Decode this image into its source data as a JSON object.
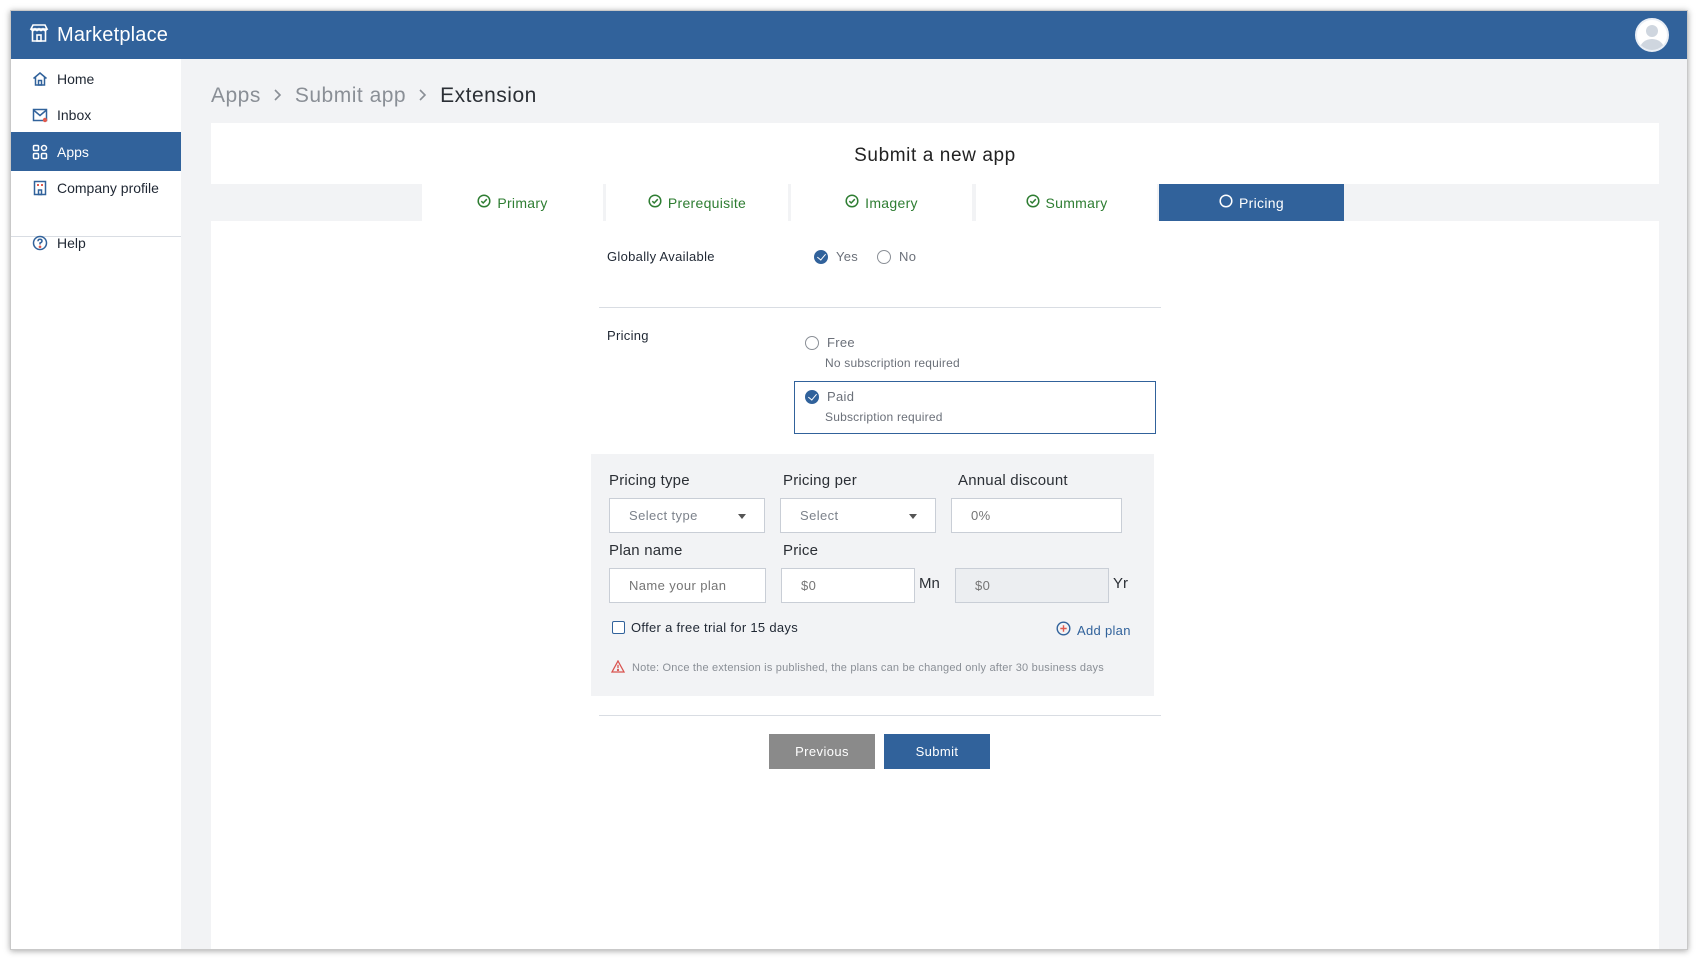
{
  "app": {
    "title": "Marketplace",
    "icon": "storefront-icon"
  },
  "user": {
    "avatar": "user-avatar"
  },
  "sidebar": {
    "items": [
      {
        "label": "Home",
        "icon": "home-icon"
      },
      {
        "label": "Inbox",
        "icon": "inbox-icon"
      },
      {
        "label": "Apps",
        "icon": "apps-grid-icon",
        "active": true
      },
      {
        "label": "Company profile",
        "icon": "building-icon"
      }
    ],
    "help": {
      "label": "Help",
      "icon": "question-circle-icon"
    }
  },
  "breadcrumb": [
    "Apps",
    "Submit app",
    "Extension"
  ],
  "panel": {
    "title": "Submit a new app"
  },
  "tabs": [
    {
      "label": "Primary",
      "state": "completed"
    },
    {
      "label": "Prerequisite",
      "state": "completed"
    },
    {
      "label": "Imagery",
      "state": "completed"
    },
    {
      "label": "Summary",
      "state": "completed"
    },
    {
      "label": "Pricing",
      "state": "active"
    }
  ],
  "form": {
    "globally_available": {
      "label": "Globally Available",
      "options": [
        {
          "label": "Yes",
          "selected": true
        },
        {
          "label": "No",
          "selected": false
        }
      ]
    },
    "pricing": {
      "label": "Pricing",
      "options": [
        {
          "label": "Free",
          "hint": "No subscription required",
          "selected": false
        },
        {
          "label": "Paid",
          "hint": "Subscription required",
          "selected": true
        }
      ]
    },
    "plan": {
      "pricing_type": {
        "label": "Pricing type",
        "value": "Select type"
      },
      "pricing_per": {
        "label": "Pricing per",
        "value": "Select"
      },
      "annual_discount": {
        "label": "Annual discount",
        "placeholder": "0%"
      },
      "plan_name": {
        "label": "Plan name",
        "placeholder": "Name your plan"
      },
      "price": {
        "label": "Price",
        "monthly": {
          "placeholder": "$0",
          "unit": "Mn"
        },
        "yearly": {
          "placeholder": "$0",
          "unit": "Yr"
        }
      },
      "free_trial": {
        "label": "Offer a free trial for 15 days",
        "checked": false
      },
      "add_plan": "Add plan",
      "note": "Note: Once the extension is published, the plans can be changed only after 30 business days"
    }
  },
  "actions": {
    "previous": "Previous",
    "submit": "Submit"
  },
  "colors": {
    "primary": "#31629b",
    "success": "#2e7d32",
    "warning": "#d9534f",
    "muted_button": "#8a8a8a"
  }
}
